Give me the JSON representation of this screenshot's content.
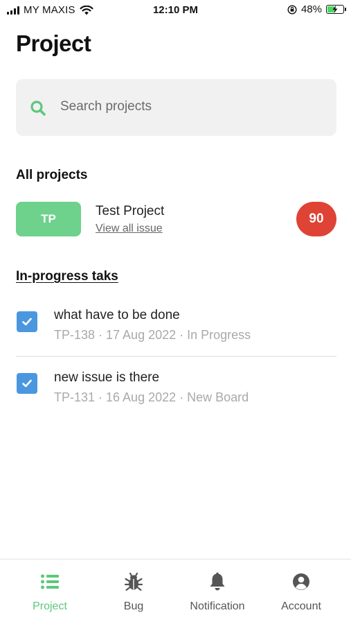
{
  "status_bar": {
    "carrier": "MY MAXIS",
    "time": "12:10 PM",
    "battery_percent": "48%",
    "battery_level": 0.48
  },
  "header": {
    "title": "Project"
  },
  "search": {
    "placeholder": "Search projects"
  },
  "projects_section": {
    "title": "All projects",
    "items": [
      {
        "badge": "TP",
        "name": "Test Project",
        "link": "View all issue",
        "count": "90"
      }
    ]
  },
  "tasks_section": {
    "title": "In-progress taks",
    "items": [
      {
        "title": "what have to be done",
        "meta": "TP-138 · 17 Aug 2022 · In Progress",
        "checked": true
      },
      {
        "title": "new issue is there",
        "meta": "TP-131 · 16 Aug 2022 · New Board",
        "checked": true
      }
    ]
  },
  "tab_bar": {
    "tabs": [
      {
        "label": "Project",
        "icon": "list-icon",
        "active": true
      },
      {
        "label": "Bug",
        "icon": "bug-icon",
        "active": false
      },
      {
        "label": "Notification",
        "icon": "bell-icon",
        "active": false
      },
      {
        "label": "Account",
        "icon": "account-icon",
        "active": false
      }
    ]
  },
  "colors": {
    "accent_green": "#5cc77c",
    "badge_green": "#6ed18c",
    "count_red": "#df4336",
    "checkbox_blue": "#4a97e0"
  }
}
